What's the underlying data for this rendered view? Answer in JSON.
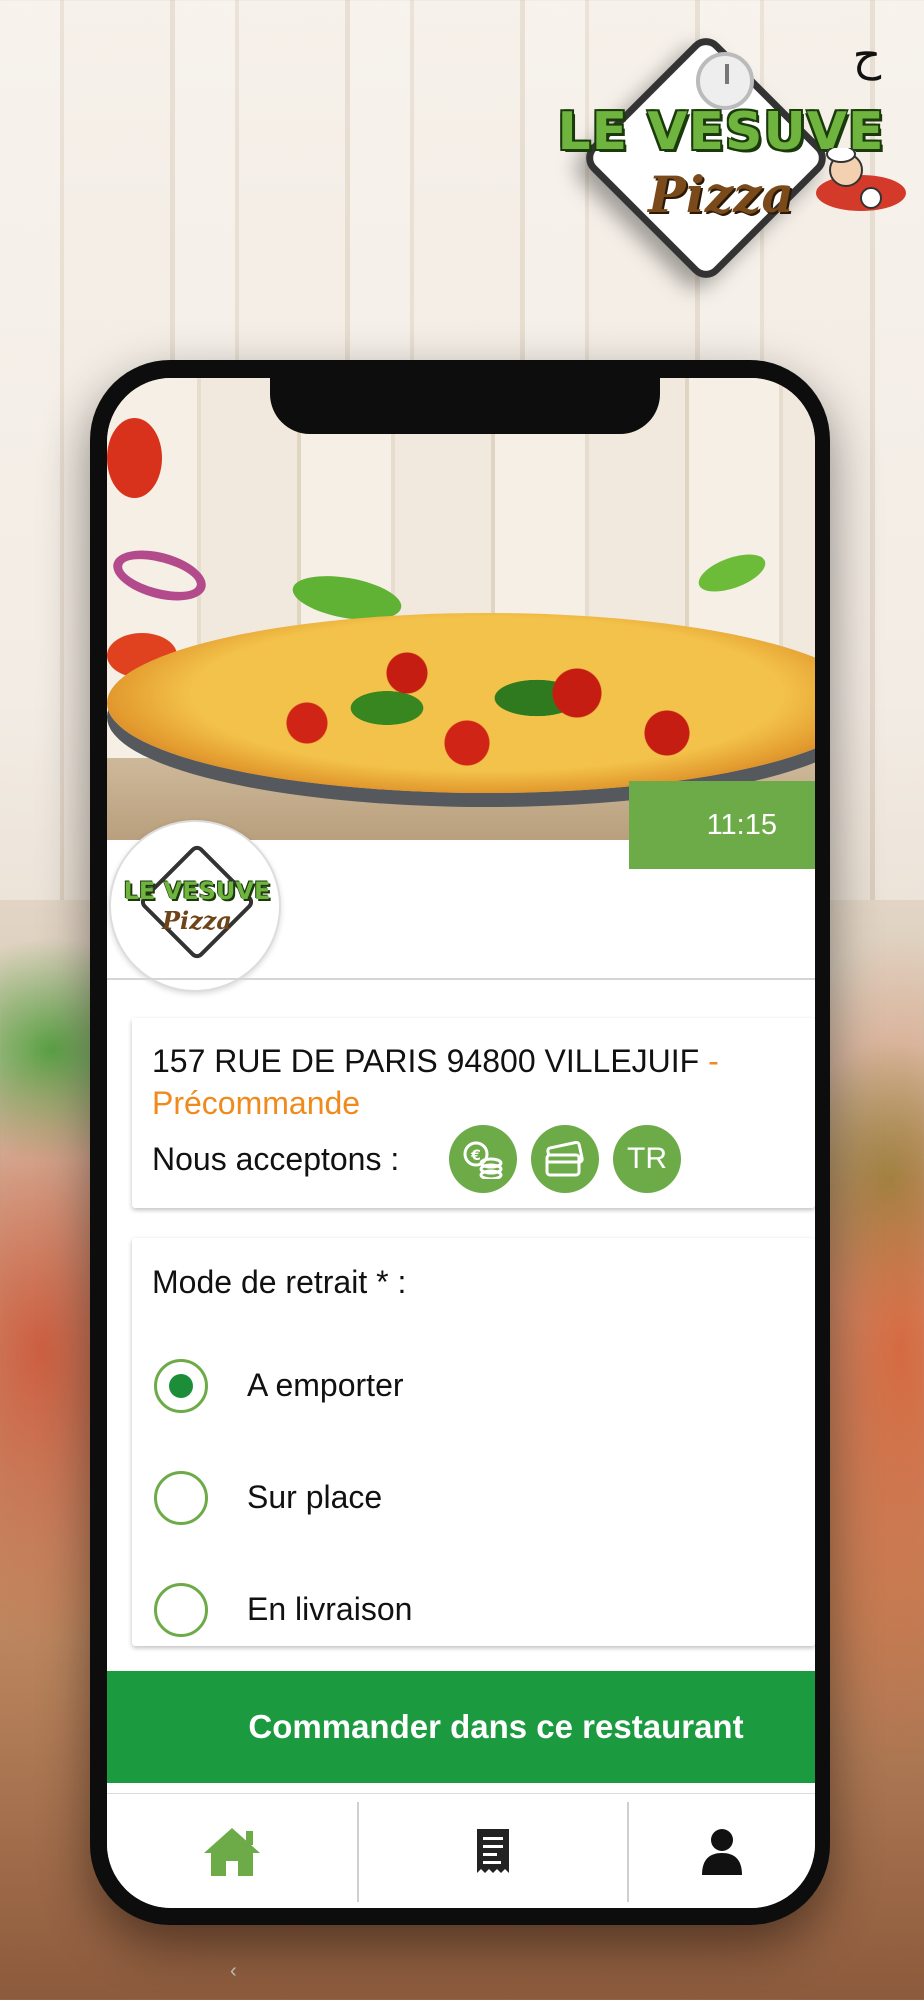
{
  "brand": {
    "title": "LE VESUVE",
    "subtitle": "Pizza",
    "arabic_mark": "الحلال"
  },
  "restaurant": {
    "pickup_time": "11:15",
    "avatar_title": "LE VESUVE",
    "avatar_subtitle": "Pizza",
    "address": "157 RUE DE PARIS 94800 VILLEJUIF",
    "separator": " - ",
    "status": "Précommande",
    "accept_label": "Nous acceptons :",
    "payment_methods": [
      {
        "name": "cash-icon",
        "label": ""
      },
      {
        "name": "credit-card-icon",
        "label": ""
      },
      {
        "name": "ticket-restaurant",
        "label": "TR"
      }
    ]
  },
  "withdrawal": {
    "title": "Mode de retrait * :",
    "options": [
      {
        "label": "A emporter",
        "selected": true
      },
      {
        "label": "Sur place",
        "selected": false
      },
      {
        "label": "En livraison",
        "selected": false
      }
    ]
  },
  "cta": {
    "label": "Commander dans ce restaurant"
  },
  "bottom_nav": {
    "items": [
      {
        "icon": "home-icon",
        "active": true
      },
      {
        "icon": "receipt-icon",
        "active": false
      },
      {
        "icon": "user-icon",
        "active": false
      }
    ]
  },
  "colors": {
    "accent_green": "#6dab48",
    "cta_green": "#1c9a40",
    "status_orange": "#f08a1c",
    "dark": "#111111"
  }
}
